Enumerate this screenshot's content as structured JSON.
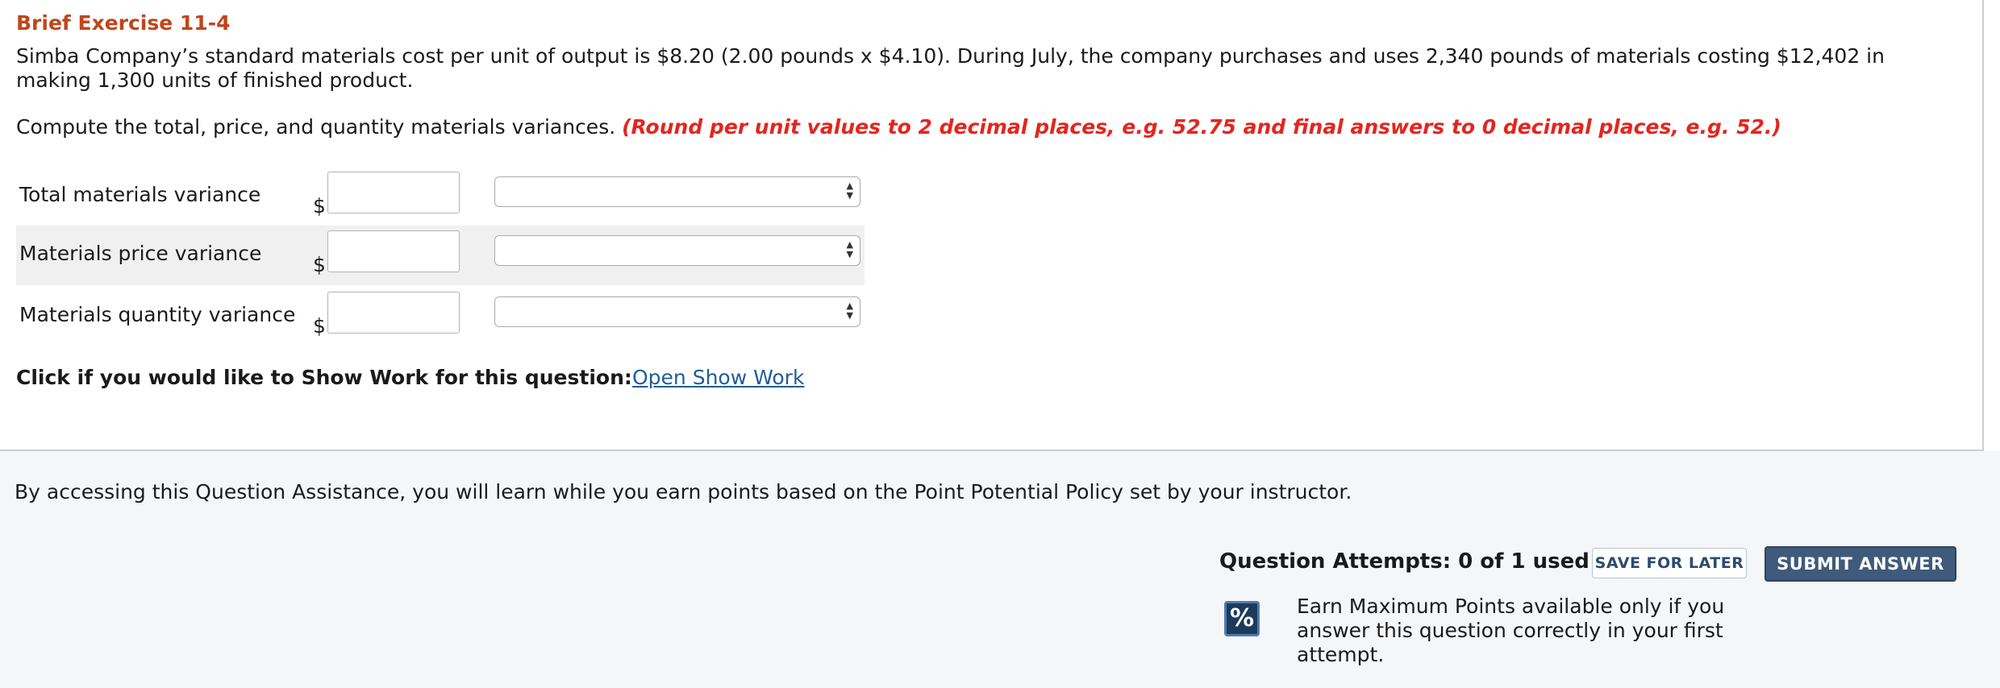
{
  "exercise": {
    "title": "Brief Exercise 11-4",
    "problem": "Simba Company’s standard materials cost per unit of output is $8.20 (2.00 pounds x $4.10). During July, the company purchases and uses 2,340 pounds of materials costing $12,402 in making 1,300 units of finished product.",
    "instruction": "Compute the total, price, and quantity materials variances.",
    "instruction_note": "(Round per unit values to 2 decimal places, e.g. 52.75 and final answers to 0 decimal places, e.g. 52.)"
  },
  "rows": [
    {
      "label": "Total materials variance",
      "currency": "$",
      "amount": "",
      "select_value": ""
    },
    {
      "label": "Materials price variance",
      "currency": "$",
      "amount": "",
      "select_value": ""
    },
    {
      "label": "Materials quantity variance",
      "currency": "$",
      "amount": "",
      "select_value": ""
    }
  ],
  "show_work": {
    "prompt": "Click if you would like to Show Work for this question:",
    "link": "Open Show Work"
  },
  "assistance": {
    "text": "By accessing this Question Assistance, you will learn while you earn points based on the Point Potential Policy set by your instructor.",
    "attempts": "Question Attempts: 0 of 1 used",
    "save_label": "SAVE FOR LATER",
    "submit_label": "SUBMIT ANSWER",
    "percent_icon": "%",
    "earn_note": "Earn Maximum Points available only if you answer this question correctly in your first attempt."
  },
  "colors": {
    "title": "#c0461c",
    "note": "#e2261f",
    "link": "#1f5d99",
    "submit_bg": "#3f5a7a"
  }
}
